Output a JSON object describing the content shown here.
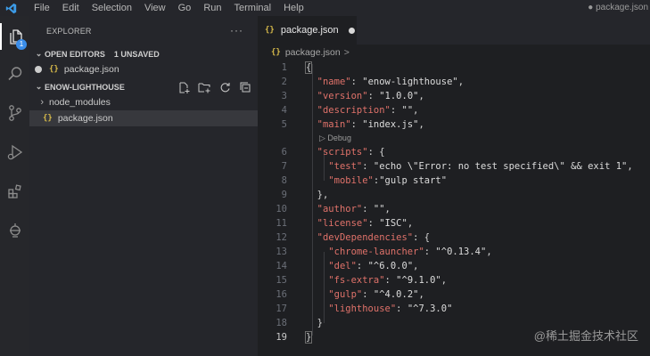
{
  "menu": {
    "items": [
      "File",
      "Edit",
      "Selection",
      "View",
      "Go",
      "Run",
      "Terminal",
      "Help"
    ],
    "window_title": "● package.json"
  },
  "activity": {
    "badge": "1"
  },
  "explorer": {
    "header": "EXPLORER",
    "more": "···",
    "open_editors": {
      "label": "OPEN EDITORS",
      "status": "1 UNSAVED",
      "files": [
        "package.json"
      ]
    },
    "workspace": {
      "label": "ENOW-LIGHTHOUSE",
      "items": [
        "node_modules",
        "package.json"
      ]
    }
  },
  "editor": {
    "tab": "package.json",
    "json_icon": "{}",
    "breadcrumb": "package.json",
    "breadcrumb_sep": ">",
    "codelens": "▷ Debug",
    "current_line": 19,
    "line_numbers": [
      "1",
      "2",
      "3",
      "4",
      "5",
      "6",
      "7",
      "8",
      "9",
      "10",
      "11",
      "12",
      "13",
      "14",
      "15",
      "16",
      "17",
      "18",
      "19"
    ]
  },
  "code": {
    "l1": "{",
    "l2k": "\"name\"",
    "l2v": "\"enow-lighthouse\"",
    "l3k": "\"version\"",
    "l3v": "\"1.0.0\"",
    "l4k": "\"description\"",
    "l4v": "\"\"",
    "l5k": "\"main\"",
    "l5v": "\"index.js\"",
    "l6k": "\"scripts\"",
    "l7k": "\"test\"",
    "l7v": "\"echo \\\"Error: no test specified\\\" && exit 1\"",
    "l8k": "\"mobile\"",
    "l8v": "\"gulp start\"",
    "l9": "},",
    "l10k": "\"author\"",
    "l10v": "\"\"",
    "l11k": "\"license\"",
    "l11v": "\"ISC\"",
    "l12k": "\"devDependencies\"",
    "l13k": "\"chrome-launcher\"",
    "l13v": "\"^0.13.4\"",
    "l14k": "\"del\"",
    "l14v": "\"^6.0.0\"",
    "l15k": "\"fs-extra\"",
    "l15v": "\"^9.1.0\"",
    "l16k": "\"gulp\"",
    "l16v": "\"^4.0.2\"",
    "l17k": "\"lighthouse\"",
    "l17v": "\"^7.3.0\"",
    "l18": "}",
    "l19": "}"
  },
  "watermark": "@稀土掘金技术社区",
  "colors": {
    "accent": "#3b8eea",
    "json_key": "#e0726a",
    "json_icon": "#d7ba4a"
  }
}
